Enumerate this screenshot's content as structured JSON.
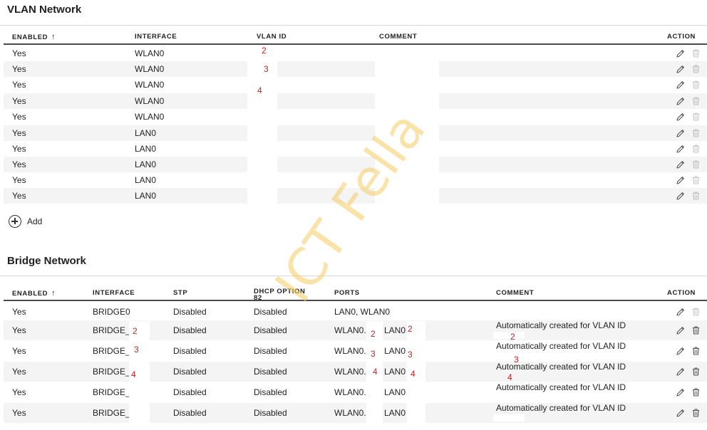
{
  "vlan": {
    "title": "VLAN Network",
    "headers": {
      "enabled": "ENABLED",
      "interface": "INTERFACE",
      "vlan_id": "VLAN ID",
      "comment": "COMMENT",
      "action": "ACTION"
    },
    "rows": [
      {
        "enabled": "Yes",
        "interface": "WLAN0"
      },
      {
        "enabled": "Yes",
        "interface": "WLAN0"
      },
      {
        "enabled": "Yes",
        "interface": "WLAN0"
      },
      {
        "enabled": "Yes",
        "interface": "WLAN0"
      },
      {
        "enabled": "Yes",
        "interface": "WLAN0"
      },
      {
        "enabled": "Yes",
        "interface": "LAN0"
      },
      {
        "enabled": "Yes",
        "interface": "LAN0"
      },
      {
        "enabled": "Yes",
        "interface": "LAN0"
      },
      {
        "enabled": "Yes",
        "interface": "LAN0"
      },
      {
        "enabled": "Yes",
        "interface": "LAN0"
      }
    ],
    "annotations": [
      "2",
      "3",
      "4"
    ],
    "add_label": "Add"
  },
  "bridge": {
    "title": "Bridge Network",
    "headers": {
      "enabled": "ENABLED",
      "interface": "INTERFACE",
      "stp": "STP",
      "dhcp_line1": "DHCP OPTION",
      "dhcp_line2": "82",
      "ports": "PORTS",
      "comment": "COMMENT",
      "action": "ACTION"
    },
    "rows": [
      {
        "enabled": "Yes",
        "interface": "BRIDGE0",
        "stp": "Disabled",
        "dhcp": "Disabled",
        "ports_a": "LAN0, WLAN0",
        "ports_b": "",
        "comment": ""
      },
      {
        "enabled": "Yes",
        "interface": "BRIDGE_",
        "stp": "Disabled",
        "dhcp": "Disabled",
        "ports_a": "WLAN0.",
        "ports_b": "LAN0",
        "comment": "Automatically created for VLAN ID"
      },
      {
        "enabled": "Yes",
        "interface": "BRIDGE_",
        "stp": "Disabled",
        "dhcp": "Disabled",
        "ports_a": "WLAN0.",
        "ports_b": "LAN0",
        "comment": "Automatically created for VLAN ID"
      },
      {
        "enabled": "Yes",
        "interface": "BRIDGE_",
        "stp": "Disabled",
        "dhcp": "Disabled",
        "ports_a": "WLAN0.",
        "ports_b": "LAN0",
        "comment": "Automatically created for VLAN ID"
      },
      {
        "enabled": "Yes",
        "interface": "BRIDGE_",
        "stp": "Disabled",
        "dhcp": "Disabled",
        "ports_a": "WLAN0.",
        "ports_b": "LAN0",
        "comment": "Automatically created for VLAN ID"
      },
      {
        "enabled": "Yes",
        "interface": "BRIDGE_",
        "stp": "Disabled",
        "dhcp": "Disabled",
        "ports_a": "WLAN0.",
        "ports_b": "LAN0",
        "comment": "Automatically created for VLAN ID"
      }
    ],
    "annotations": [
      "2",
      "3",
      "4"
    ]
  },
  "watermark": "ICT Fella",
  "colors": {
    "annotation": "#cc1f1f",
    "watermark": "#f6cd63",
    "row_alt": "#f4f4f4",
    "header_rule": "#4a4a4a"
  },
  "icons": {
    "edit": "pencil-icon",
    "delete": "trash-icon",
    "add": "plus-circle-icon",
    "sort": "arrow-up-icon"
  }
}
